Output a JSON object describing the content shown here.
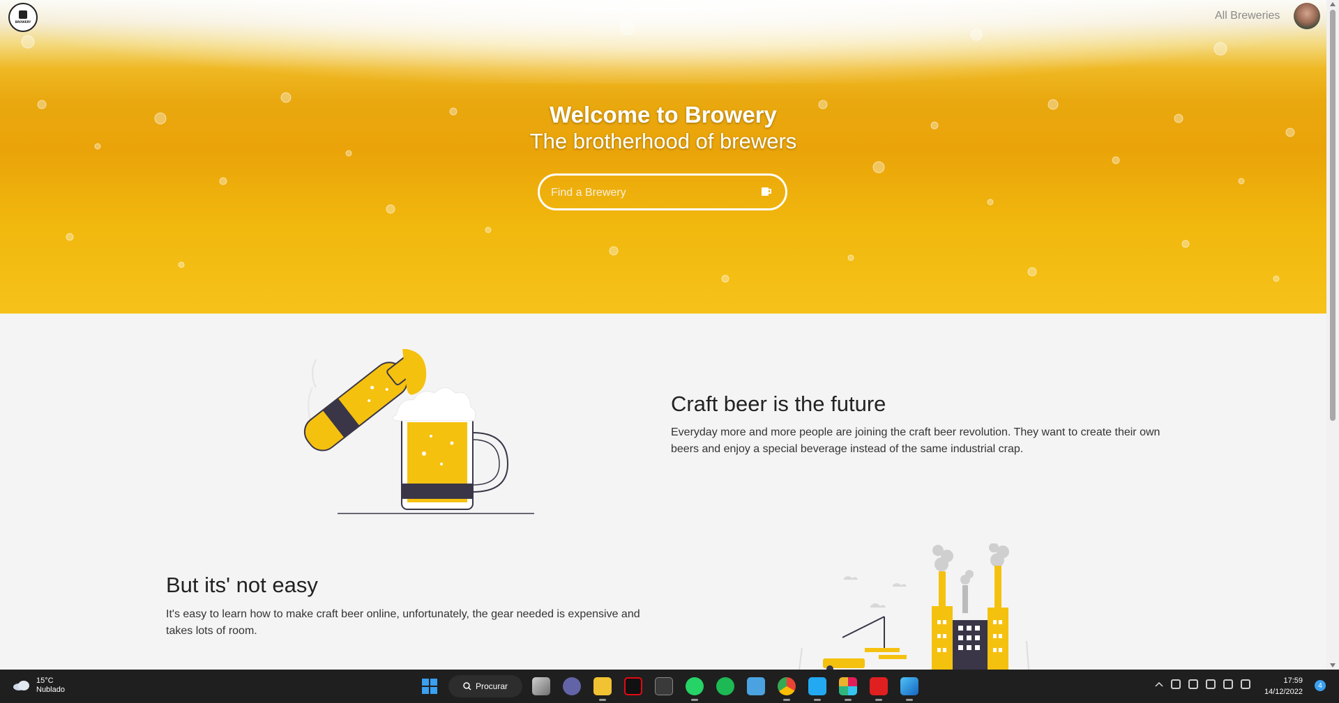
{
  "header": {
    "logo_text": "BROWERY",
    "nav_link": "All Breweries"
  },
  "hero": {
    "title": "Welcome to Browery",
    "subtitle": "The brotherhood of brewers",
    "search_placeholder": "Find a Brewery"
  },
  "sections": {
    "craft": {
      "title": "Craft beer is the future",
      "text": "Everyday more and more people are joining the craft beer revolution. They want to create their own beers and enjoy a special beverage instead of the same industrial crap."
    },
    "easy": {
      "title": "But its' not easy",
      "text": "It's easy to learn how to make craft beer online, unfortunately, the gear needed is expensive and takes lots of room."
    }
  },
  "colors": {
    "beer_yellow": "#f5c10f",
    "dark_band": "#3a3648",
    "taskbar": "#1f1f1f",
    "accent_blue": "#3aa0f0"
  },
  "taskbar": {
    "weather_temp": "15°C",
    "weather_desc": "Nublado",
    "search_label": "Procurar",
    "apps": [
      "task-view-icon",
      "teams-icon",
      "file-explorer-icon",
      "netflix-icon",
      "terminal-icon",
      "whatsapp-icon",
      "spotify-icon",
      "notepad-icon",
      "chrome-icon",
      "vscode-icon",
      "slack-icon",
      "acrobat-icon",
      "photos-icon"
    ],
    "time": "17:59",
    "date": "14/12/2022",
    "notification_count": "4"
  }
}
